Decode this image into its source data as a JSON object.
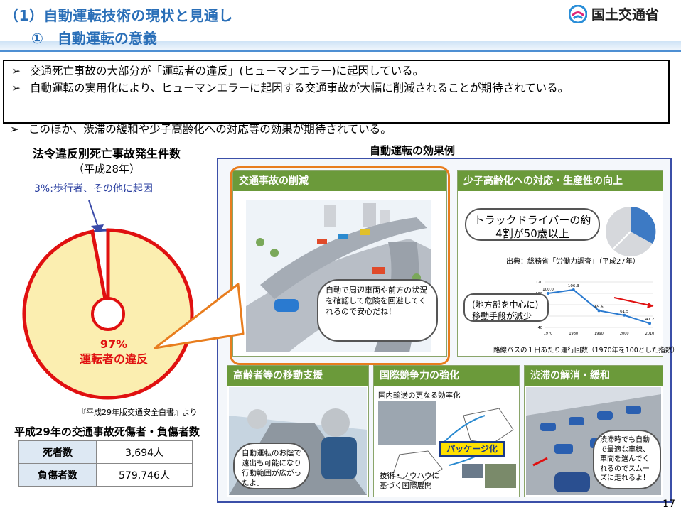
{
  "header": {
    "title": "（1）自動運転技術の現状と見通し",
    "subtitle": "①　自動運転の意義",
    "ministry": "国土交通省"
  },
  "bullets": [
    "交通死亡事故の大部分が「運転者の違反」(ヒューマンエラー)に起因している。",
    "自動運転の実用化により、ヒューマンエラーに起因する交通事故が大幅に削減されることが期待されている。",
    "このほか、渋滞の緩和や少子高齢化への対応等の効果が期待されている。"
  ],
  "bullet_marker": "➢",
  "pie_section": {
    "title": "法令違反別死亡事故発生件数",
    "year": "（平成28年）",
    "minor_note": "3%:歩行者、その他に起因",
    "major_pct": "97%",
    "major_label": "運転者の違反",
    "source": "『平成29年版交通安全白書』より"
  },
  "chart_data": {
    "type": "pie",
    "categories": [
      "運転者の違反",
      "歩行者、その他に起因"
    ],
    "values": [
      97,
      3
    ]
  },
  "stats": {
    "title": "平成29年の交通事故死傷者・負傷者数",
    "rows": [
      {
        "label": "死者数",
        "value": "3,694人"
      },
      {
        "label": "負傷者数",
        "value": "579,746人"
      }
    ]
  },
  "effects": {
    "title": "自動運転の効果例",
    "panel1": {
      "title": "交通事故の削減",
      "bubble": "自動で周辺車両や前方の状況を確認して危険を回避してくれるので安心だね！"
    },
    "panel2": {
      "title": "少子高齢化への対応・生産性の向上",
      "bubble_truck": "トラックドライバーの約4割が50歳以上",
      "source": "出典：総務省「労働力調査」（平成27年）",
      "bubble_bus": "(地方部を中心に)移動手段が減少",
      "bus_caption": "路線バスの１日あたり運行回数（1970年を100とした指数）",
      "bus_values": [
        "100.0",
        "106.3",
        "69.6",
        "61.5",
        "47.2"
      ],
      "bus_years": [
        "1970",
        "1980",
        "1990",
        "2000",
        "2010"
      ],
      "bus_yticks": [
        "120",
        "100",
        "80",
        "60",
        "40"
      ]
    },
    "panel3": {
      "title": "高齢者等の移動支援",
      "bubble": "自動運転のお陰で遠出も可能になり行動範囲が広がったよ。"
    },
    "panel4": {
      "title": "国際競争力の強化",
      "caption_top": "国内輸送の更なる効率化",
      "package": "パッケージ化",
      "caption_bottom": "技術・ノウハウに基づく国際展開"
    },
    "panel5": {
      "title": "渋滞の解消・緩和",
      "bubble": "渋滞時でも自動で最適な車線、車間を選んでくれるのでスムーズに走れるよ！"
    }
  },
  "page_number": "17",
  "colors": {
    "header": "#2a6fb8",
    "pie_major": "#fbeeb0",
    "pie_border": "#e01010",
    "pie_minor": "#3a4aa8",
    "panel_title": "#6b9a3a",
    "highlight": "#e87d1e"
  }
}
